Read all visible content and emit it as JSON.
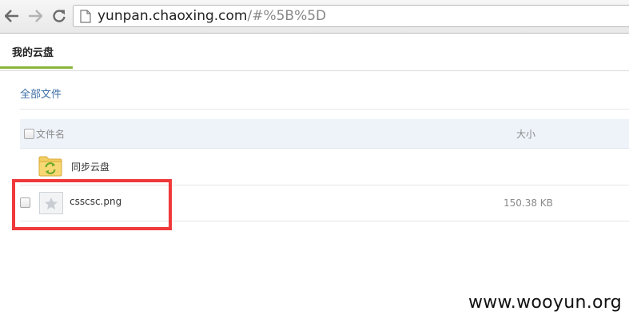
{
  "browser": {
    "url_host": "yunpan.chaoxing.com",
    "url_path": "/#%5B%5D"
  },
  "header": {
    "active_tab": "我的云盘",
    "accent_color": "#8bb53a"
  },
  "breadcrumb": "全部文件",
  "table": {
    "columns": [
      "文件名",
      "大小"
    ],
    "rows": [
      {
        "name": "同步云盘",
        "size": "",
        "icon": "sync-folder-icon"
      },
      {
        "name": "csscsc.png",
        "size": "150.38 KB",
        "icon": "image-file-icon"
      }
    ]
  },
  "annotation": {
    "highlight_color": "#f0393a"
  },
  "watermark": "www.wooyun.org"
}
